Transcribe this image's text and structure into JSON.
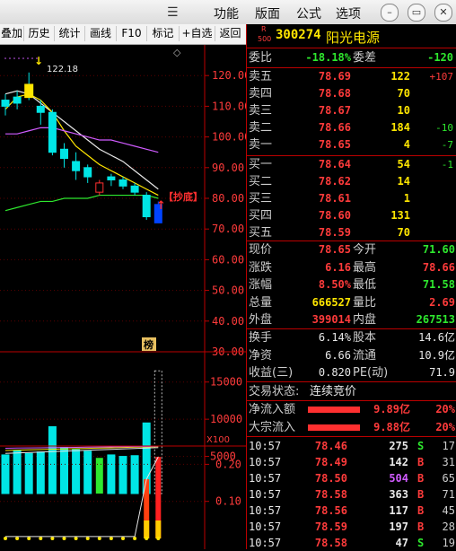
{
  "menu": {
    "items": [
      "功能",
      "版面",
      "公式",
      "选项"
    ]
  },
  "window_buttons": [
    "–",
    "▭",
    "✕"
  ],
  "toolbar": {
    "items": [
      "叠加",
      "历史",
      "统计",
      "画线",
      "F10",
      "标记",
      "+自选",
      "返回"
    ]
  },
  "stock": {
    "badge_top": "R",
    "badge_bottom": "500",
    "code": "300274",
    "name": "阳光电源"
  },
  "weibi": {
    "label1": "委比",
    "value1": "-18.18%",
    "label2": "委差",
    "value2": "-120"
  },
  "asks": [
    {
      "label": "卖五",
      "price": "78.69",
      "vol": "122",
      "chg": "+107"
    },
    {
      "label": "卖四",
      "price": "78.68",
      "vol": "70",
      "chg": ""
    },
    {
      "label": "卖三",
      "price": "78.67",
      "vol": "10",
      "chg": ""
    },
    {
      "label": "卖二",
      "price": "78.66",
      "vol": "184",
      "chg": "-10"
    },
    {
      "label": "卖一",
      "price": "78.65",
      "vol": "4",
      "chg": "-7"
    }
  ],
  "bids": [
    {
      "label": "买一",
      "price": "78.64",
      "vol": "54",
      "chg": "-1"
    },
    {
      "label": "买二",
      "price": "78.62",
      "vol": "14",
      "chg": ""
    },
    {
      "label": "买三",
      "price": "78.61",
      "vol": "1",
      "chg": ""
    },
    {
      "label": "买四",
      "price": "78.60",
      "vol": "131",
      "chg": ""
    },
    {
      "label": "买五",
      "price": "78.59",
      "vol": "70",
      "chg": ""
    }
  ],
  "quote": [
    {
      "l1": "现价",
      "v1": "78.65",
      "l2": "今开",
      "v2": "71.60",
      "c1": "red",
      "c2": "green"
    },
    {
      "l1": "涨跌",
      "v1": "6.16",
      "l2": "最高",
      "v2": "78.66",
      "c1": "red",
      "c2": "red"
    },
    {
      "l1": "涨幅",
      "v1": "8.50%",
      "l2": "最低",
      "v2": "71.58",
      "c1": "red",
      "c2": "green"
    },
    {
      "l1": "总量",
      "v1": "666527",
      "l2": "量比",
      "v2": "2.69",
      "c1": "yellow",
      "c2": "red"
    },
    {
      "l1": "外盘",
      "v1": "399014",
      "l2": "内盘",
      "v2": "267513",
      "c1": "red",
      "c2": "green"
    }
  ],
  "fundamentals": [
    {
      "l1": "换手",
      "v1": "6.14%",
      "l2": "股本",
      "v2": "14.6亿"
    },
    {
      "l1": "净资",
      "v1": "6.66",
      "l2": "流通",
      "v2": "10.9亿"
    },
    {
      "l1": "收益(三)",
      "v1": "0.820",
      "l2": "PE(动)",
      "v2": "71.9"
    }
  ],
  "trade_status": {
    "label": "交易状态:",
    "value": "连续竞价"
  },
  "flows": [
    {
      "label": "净流入额",
      "v1": "9.89亿",
      "v2": "20%"
    },
    {
      "label": "大宗流入",
      "v1": "9.88亿",
      "v2": "20%"
    }
  ],
  "ticks": [
    {
      "time": "10:57",
      "price": "78.46",
      "vol": "275",
      "side": "S",
      "n": "17",
      "vc": "white"
    },
    {
      "time": "10:57",
      "price": "78.49",
      "vol": "142",
      "side": "B",
      "n": "31",
      "vc": "white"
    },
    {
      "time": "10:57",
      "price": "78.50",
      "vol": "504",
      "side": "B",
      "n": "65",
      "vc": "mag"
    },
    {
      "time": "10:57",
      "price": "78.58",
      "vol": "363",
      "side": "B",
      "n": "71",
      "vc": "white"
    },
    {
      "time": "10:57",
      "price": "78.56",
      "vol": "117",
      "side": "B",
      "n": "45",
      "vc": "white"
    },
    {
      "time": "10:57",
      "price": "78.59",
      "vol": "197",
      "side": "B",
      "n": "28",
      "vc": "white"
    },
    {
      "time": "10:57",
      "price": "78.58",
      "vol": "47",
      "side": "S",
      "n": "19",
      "vc": "white"
    }
  ],
  "chart": {
    "price_axis": [
      "120.00",
      "110.00",
      "100.00",
      "90.00",
      "80.00",
      "70.00",
      "60.00",
      "50.00",
      "40.00",
      "30.00"
    ],
    "volume_axis": [
      "15000",
      "10000",
      "5000"
    ],
    "volume_unit": "X100",
    "ind_axis": [
      "0.20",
      "0.10"
    ],
    "high_label": "122.18",
    "signal_label": "【抄底】",
    "bang_label": "榜",
    "diamond": "◇",
    "arrow_down": "↓",
    "arrow_up": "↑"
  },
  "chart_data": {
    "type": "candlestick",
    "candles": [
      {
        "o": 112,
        "c": 110,
        "h": 114,
        "l": 107
      },
      {
        "o": 113,
        "c": 111,
        "h": 115,
        "l": 109
      },
      {
        "o": 117,
        "c": 113,
        "h": 121,
        "l": 112
      },
      {
        "o": 110,
        "c": 108,
        "h": 112,
        "l": 104
      },
      {
        "o": 108,
        "c": 95,
        "h": 109,
        "l": 94
      },
      {
        "o": 96,
        "c": 93,
        "h": 98,
        "l": 90
      },
      {
        "o": 92,
        "c": 89,
        "h": 95,
        "l": 86
      },
      {
        "o": 90,
        "c": 87,
        "h": 91,
        "l": 85
      },
      {
        "o": 82,
        "c": 85,
        "h": 86,
        "l": 81
      },
      {
        "o": 87,
        "c": 86,
        "h": 88,
        "l": 84
      },
      {
        "o": 86,
        "c": 84,
        "h": 87,
        "l": 83
      },
      {
        "o": 84,
        "c": 82,
        "h": 85,
        "l": 81
      },
      {
        "o": 81,
        "c": 74,
        "h": 82,
        "l": 73
      },
      {
        "o": 72,
        "c": 78,
        "h": 79,
        "l": 72
      }
    ],
    "ma_yellow": [
      109,
      113,
      114,
      112,
      108,
      102,
      97,
      94,
      91,
      89,
      87,
      85,
      83,
      81
    ],
    "ma_white": [
      114,
      115,
      114,
      111,
      108,
      105,
      102,
      99,
      96,
      94,
      92,
      89,
      86,
      83
    ],
    "ma_magenta": [
      101,
      101,
      102,
      103,
      103,
      102,
      101,
      100,
      99,
      99,
      98,
      97,
      96,
      95
    ],
    "ma_green": [
      76,
      77,
      78,
      79,
      79,
      80,
      80,
      80,
      81,
      81,
      81,
      81,
      81,
      80
    ],
    "volume": [
      5200,
      5800,
      5400,
      5600,
      9000,
      6200,
      5900,
      5700,
      4800,
      5200,
      5000,
      5100,
      9500,
      16500
    ],
    "volume_up": [
      false,
      false,
      false,
      false,
      false,
      false,
      false,
      false,
      true,
      false,
      false,
      false,
      false,
      true
    ],
    "indicator": [
      0.005,
      0.005,
      0.005,
      0.005,
      0.005,
      0.005,
      0.005,
      0.005,
      0.005,
      0.005,
      0.005,
      0.005,
      0.16,
      0.22
    ]
  }
}
